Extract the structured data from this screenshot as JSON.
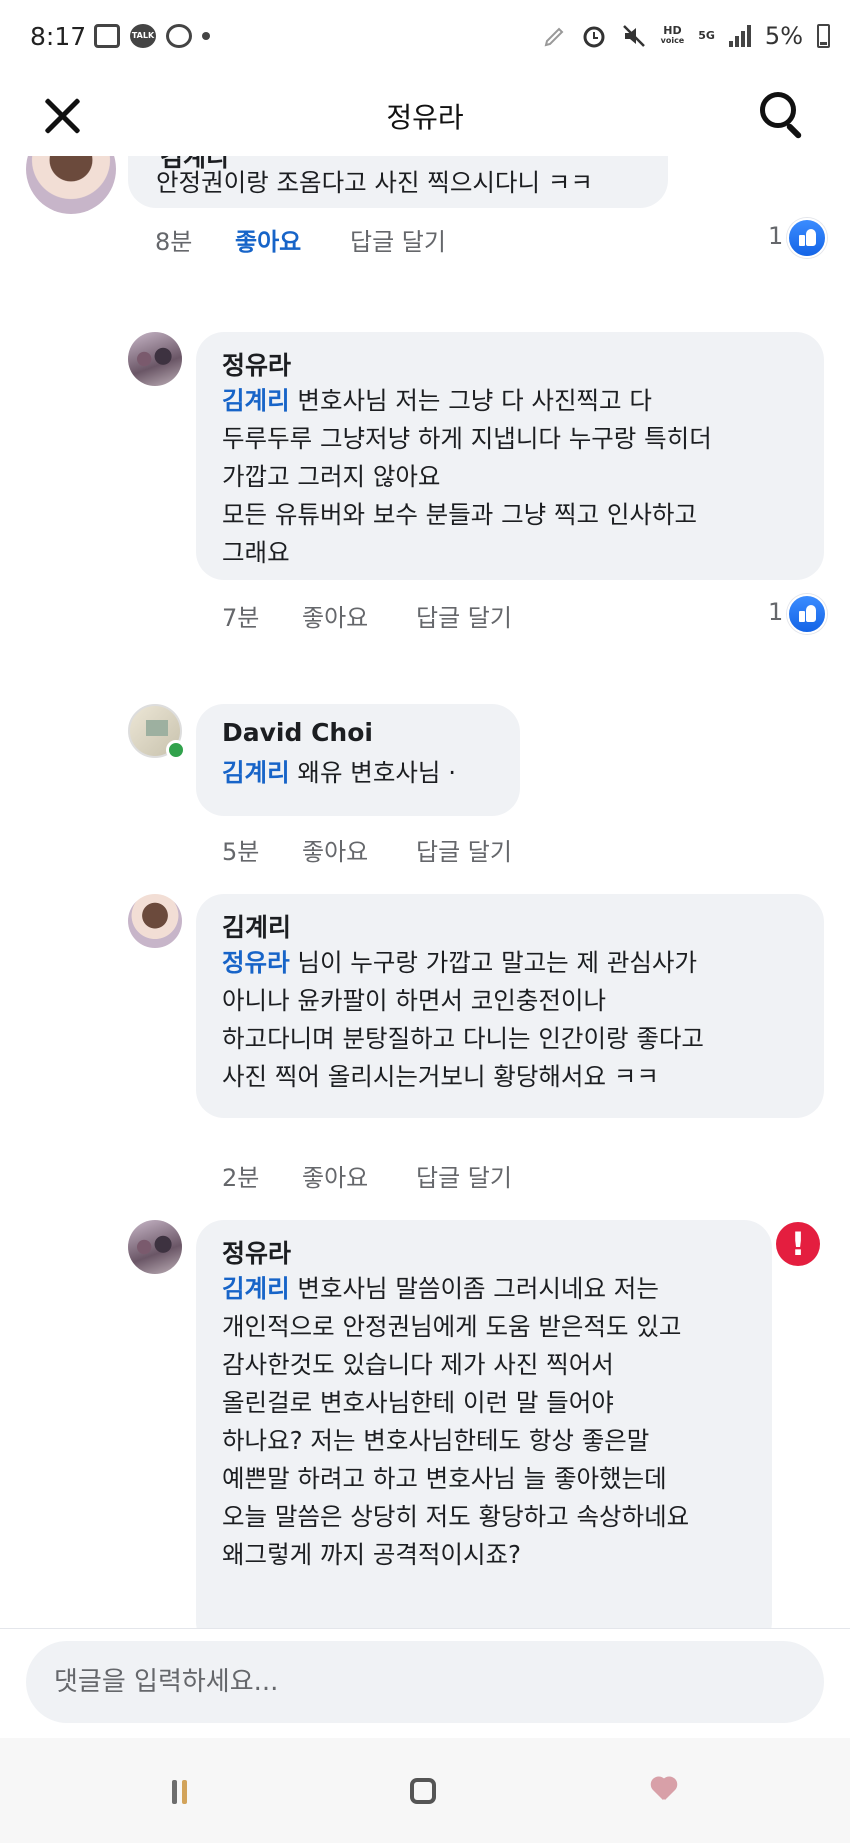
{
  "status_bar": {
    "time": "8:17",
    "talk_label": "TALK",
    "hd_label": "HD",
    "voice_label": "voice",
    "network_label": "5G",
    "battery_text": "5%"
  },
  "header": {
    "title": "정유라"
  },
  "comments": [
    {
      "author": "김계리",
      "lines": [
        "안정권이랑 조옴다고 사진 찍으시다니 ㅋㅋ"
      ],
      "time": "8분",
      "like_label": "좋아요",
      "reply_label": "답글 달기",
      "reaction_count": "1",
      "liked": true
    },
    {
      "author": "정유라",
      "mention": "김계리",
      "lines": [
        " 변호사님 저는 그냥 다 사진찍고 다",
        "두루두루 그냥저냥 하게 지냅니다 누구랑 특히더",
        "가깝고 그러지 않아요",
        "모든 유튜버와 보수 분들과 그냥 찍고 인사하고",
        "그래요"
      ],
      "time": "7분",
      "like_label": "좋아요",
      "reply_label": "답글 달기",
      "reaction_count": "1"
    },
    {
      "author": "David Choi",
      "mention": "김계리",
      "lines": [
        " 왜유 변호사님 ·"
      ],
      "time": "5분",
      "like_label": "좋아요",
      "reply_label": "답글 달기"
    },
    {
      "author": "김계리",
      "mention": "정유라",
      "lines": [
        " 님이 누구랑 가깝고 말고는 제 관심사가",
        "아니나 윤카팔이 하면서 코인충전이나",
        "하고다니며 분탕질하고 다니는 인간이랑 좋다고",
        "사진 찍어 올리시는거보니 황당해서요 ㅋㅋ"
      ],
      "time": "2분",
      "like_label": "좋아요",
      "reply_label": "답글 달기"
    },
    {
      "author": "정유라",
      "mention": "김계리",
      "lines": [
        " 변호사님 말씀이좀 그러시네요 저는",
        "개인적으로 안정권님에게 도움 받은적도 있고",
        "감사한것도 있습니다 제가 사진 찍어서",
        "올린걸로 변호사님한테 이런 말 들어야",
        "하나요? 저는 변호사님한테도 항상 좋은말",
        "예쁜말 하려고 하고 변호사님 늘 좋아했는데",
        "오늘 말씀은 상당히 저도 황당하고 속상하네요",
        "왜그렇게 까지 공격적이시죠?"
      ],
      "error_mark": "!"
    }
  ],
  "input": {
    "placeholder": "댓글을 입력하세요..."
  },
  "colors": {
    "accent": "#1764c8",
    "bubble": "#f0f2f5",
    "error": "#e41e3f",
    "online": "#31a24c"
  }
}
